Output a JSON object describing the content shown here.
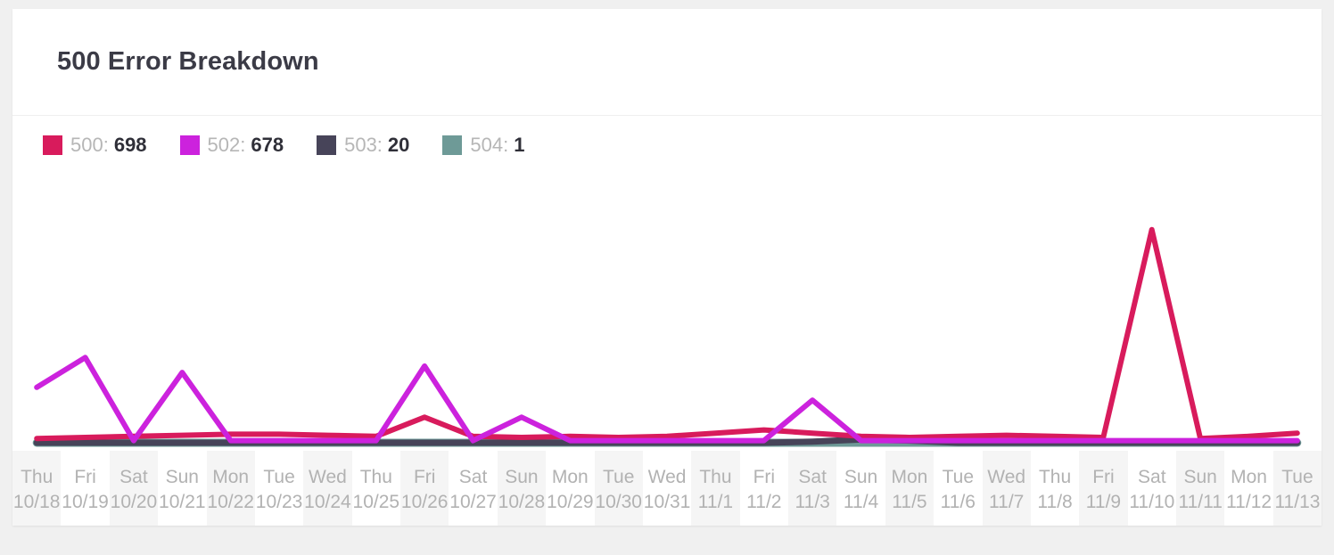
{
  "card": {
    "title": "500 Error Breakdown"
  },
  "legend": {
    "items": [
      {
        "key": "500:",
        "value": "698",
        "color": "#d81b5c",
        "name": "legend-item-500"
      },
      {
        "key": "502:",
        "value": "678",
        "color": "#cc22dd",
        "name": "legend-item-502"
      },
      {
        "key": "503:",
        "value": "20",
        "color": "#474459",
        "name": "legend-item-503"
      },
      {
        "key": "504:",
        "value": "1",
        "color": "#6e9a97",
        "name": "legend-item-504"
      }
    ]
  },
  "chart_data": {
    "type": "line",
    "title": "500 Error Breakdown",
    "xlabel": "",
    "ylabel": "",
    "grid": false,
    "legend_position": "top-left",
    "ylim": [
      0,
      240
    ],
    "categories": [
      "Thu 10/18",
      "Fri 10/19",
      "Sat 10/20",
      "Sun 10/21",
      "Mon 10/22",
      "Tue 10/23",
      "Wed 10/24",
      "Thu 10/25",
      "Fri 10/26",
      "Sat 10/27",
      "Sun 10/28",
      "Mon 10/29",
      "Tue 10/30",
      "Wed 10/31",
      "Thu 11/1",
      "Fri 11/2",
      "Sat 11/3",
      "Sun 11/4",
      "Mon 11/5",
      "Tue 11/6",
      "Wed 11/7",
      "Thu 11/8",
      "Fri 11/9",
      "Sat 11/10",
      "Sun 11/11",
      "Mon 11/12",
      "Tue 11/13"
    ],
    "days": [
      "Thu",
      "Fri",
      "Sat",
      "Sun",
      "Mon",
      "Tue",
      "Wed",
      "Thu",
      "Fri",
      "Sat",
      "Sun",
      "Mon",
      "Tue",
      "Wed",
      "Thu",
      "Fri",
      "Sat",
      "Sun",
      "Mon",
      "Tue",
      "Wed",
      "Thu",
      "Fri",
      "Sat",
      "Sun",
      "Mon",
      "Tue"
    ],
    "dates": [
      "10/18",
      "10/19",
      "10/20",
      "10/21",
      "10/22",
      "10/23",
      "10/24",
      "10/25",
      "10/26",
      "10/27",
      "10/28",
      "10/29",
      "10/30",
      "10/31",
      "11/1",
      "11/2",
      "11/3",
      "11/4",
      "11/5",
      "11/6",
      "11/7",
      "11/8",
      "11/9",
      "11/10",
      "11/11",
      "11/12",
      "11/13"
    ],
    "series": [
      {
        "name": "500",
        "color": "#d81b5c",
        "total": 698,
        "values": [
          4,
          5,
          6,
          7,
          8,
          8,
          7,
          6,
          24,
          6,
          5,
          6,
          5,
          6,
          9,
          12,
          9,
          6,
          5,
          6,
          7,
          6,
          5,
          200,
          4,
          6,
          9
        ]
      },
      {
        "name": "502",
        "color": "#cc22dd",
        "total": 678,
        "values": [
          52,
          80,
          2,
          66,
          2,
          2,
          2,
          2,
          72,
          2,
          24,
          2,
          2,
          2,
          2,
          2,
          40,
          2,
          2,
          2,
          2,
          2,
          2,
          2,
          2,
          2,
          2
        ]
      },
      {
        "name": "503",
        "color": "#474459",
        "total": 20,
        "values": [
          0,
          0,
          0,
          0,
          0,
          0,
          0,
          0,
          0,
          0,
          0,
          0,
          0,
          0,
          0,
          0,
          1,
          3,
          2,
          0,
          0,
          0,
          0,
          0,
          0,
          0,
          0
        ]
      },
      {
        "name": "504",
        "color": "#6e9a97",
        "total": 1,
        "values": [
          0,
          0,
          0,
          0,
          0,
          0,
          0,
          0,
          0,
          0,
          0,
          0,
          0,
          0,
          0,
          0,
          0,
          0,
          0,
          0,
          0,
          0,
          0,
          0,
          0,
          0,
          0
        ]
      }
    ]
  }
}
